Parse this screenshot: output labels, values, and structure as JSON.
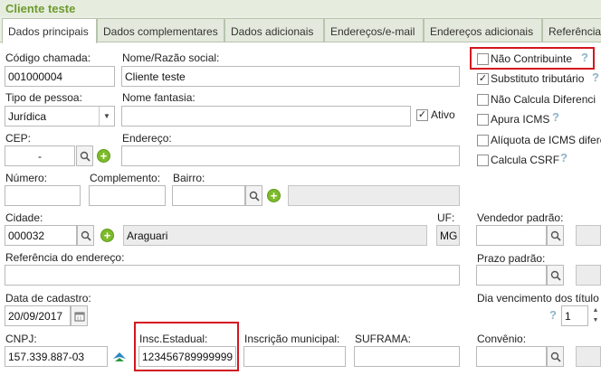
{
  "window": {
    "title": "Cliente teste"
  },
  "tabs": [
    {
      "label": "Dados principais"
    },
    {
      "label": "Dados complementares"
    },
    {
      "label": "Dados adicionais"
    },
    {
      "label": "Endereços/e-mail"
    },
    {
      "label": "Endereços adicionais"
    },
    {
      "label": "Referências"
    }
  ],
  "form": {
    "codigo": {
      "label": "Código chamada:",
      "value": "001000004"
    },
    "nome": {
      "label": "Nome/Razão social:",
      "value": "Cliente teste"
    },
    "tipo_pessoa": {
      "label": "Tipo de pessoa:",
      "value": "Jurídica"
    },
    "nome_fantasia": {
      "label": "Nome fantasia:",
      "value": ""
    },
    "ativo": {
      "label": "Ativo",
      "checked": true
    },
    "cep": {
      "label": "CEP:",
      "value": "-"
    },
    "endereco": {
      "label": "Endereço:",
      "value": ""
    },
    "numero": {
      "label": "Número:",
      "value": ""
    },
    "complemento": {
      "label": "Complemento:",
      "value": ""
    },
    "bairro": {
      "label": "Bairro:",
      "value": ""
    },
    "cidade": {
      "label": "Cidade:",
      "value": "000032",
      "name": "Araguari"
    },
    "uf": {
      "label": "UF:",
      "value": "MG"
    },
    "referencia": {
      "label": "Referência do endereço:",
      "value": ""
    },
    "data_cadastro": {
      "label": "Data de cadastro:",
      "value": "20/09/2017"
    },
    "cnpj": {
      "label": "CNPJ:",
      "value": "157.339.887-03"
    },
    "insc_estadual": {
      "label": "Insc.Estadual:",
      "value": "123456789999999"
    },
    "insc_municipal": {
      "label": "Inscrição municipal:",
      "value": ""
    },
    "suframa": {
      "label": "SUFRAMA:",
      "value": ""
    }
  },
  "right": {
    "checks": [
      {
        "label": "Não Contribuinte",
        "checked": false
      },
      {
        "label": "Substituto tributário",
        "checked": true
      },
      {
        "label": "Não Calcula Diferenci",
        "checked": false
      },
      {
        "label": "Apura ICMS",
        "checked": false
      },
      {
        "label": "Alíquota de ICMS difere",
        "checked": false
      },
      {
        "label": "Calcula CSRF",
        "checked": false
      }
    ],
    "vendedor": {
      "label": "Vendedor padrão:",
      "value": ""
    },
    "prazo": {
      "label": "Prazo padrão:",
      "value": ""
    },
    "dia_venc": {
      "label": "Dia vencimento dos título",
      "value": "1"
    },
    "convenio": {
      "label": "Convênio:",
      "value": ""
    }
  },
  "colors": {
    "accent": "#6e9a2e",
    "highlight": "#d4161f",
    "plus": "#7dbb2a"
  }
}
